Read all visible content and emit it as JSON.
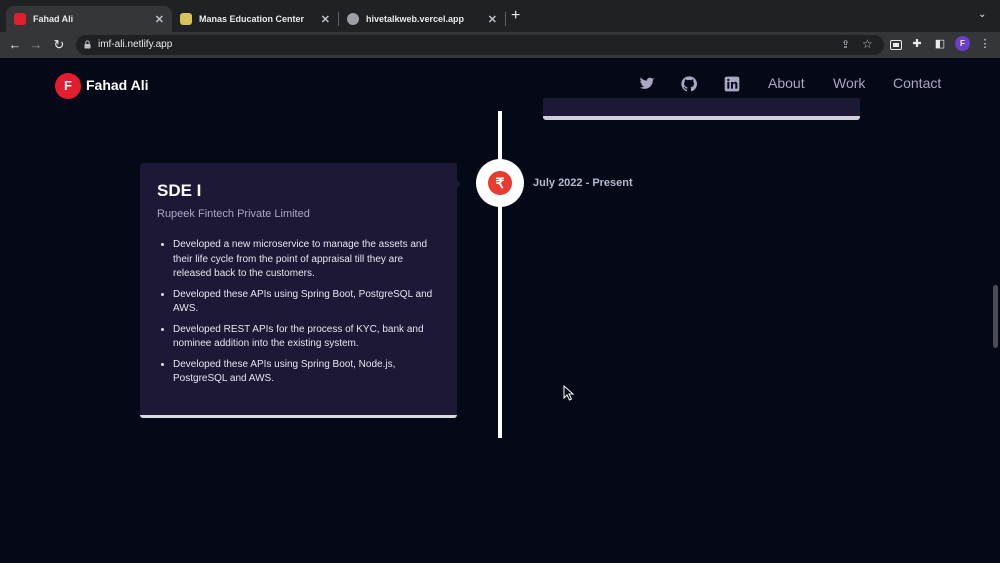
{
  "browser": {
    "tabs": [
      {
        "title": "Fahad Ali",
        "active": true,
        "favicon_color": "#e11d2e"
      },
      {
        "title": "Manas Education Center",
        "active": false,
        "favicon_color": "#d8c25a"
      },
      {
        "title": "hivetalkweb.vercel.app",
        "active": false,
        "favicon_color": "#9aa0a6"
      }
    ],
    "close_glyph": "✕",
    "new_tab_glyph": "+",
    "tab_menu_glyph": "⌄",
    "url": "imf-ali.netlify.app",
    "back_glyph": "←",
    "forward_glyph": "→",
    "reload_glyph": "↻",
    "share_glyph": "⇪",
    "star_glyph": "☆",
    "extension_glyph": "✚",
    "sidebar_glyph": "◧",
    "more_glyph": "⋮",
    "profile_initial": "F"
  },
  "site": {
    "logo_letter": "F",
    "brand": "Fahad Ali",
    "nav": [
      "About",
      "Work",
      "Contact"
    ],
    "social_icons": [
      "twitter-icon",
      "github-icon",
      "linkedin-icon"
    ],
    "accent_color": "#e11d2e",
    "background_color": "#050816",
    "card_color": "#1d1836"
  },
  "experience": {
    "role": "SDE I",
    "company": "Rupeek Fintech Private Limited",
    "date": "July 2022 - Present",
    "node_glyph": "₹",
    "points": [
      "Developed a new microservice to manage the assets and their life cycle from the point of appraisal till they are released back to the customers.",
      "Developed these APIs using Spring Boot, PostgreSQL and AWS.",
      "Developed REST APIs for the process of KYC, bank and nominee addition into the existing system.",
      "Developed these APIs using Spring Boot, Node.js, PostgreSQL and AWS."
    ]
  }
}
